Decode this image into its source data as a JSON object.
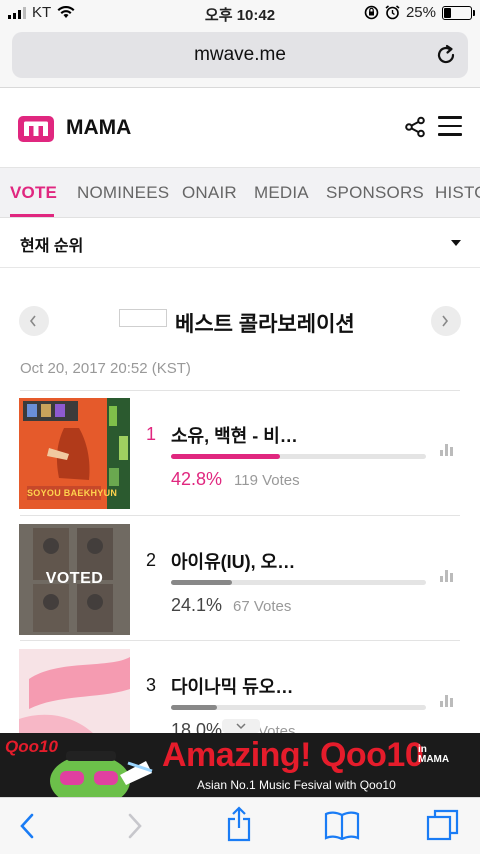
{
  "status_bar": {
    "carrier": "KT",
    "time": "오후 10:42",
    "battery": "25%",
    "battery_level": 0.25
  },
  "browser": {
    "url": "mwave.me"
  },
  "header": {
    "brand": "MAMA",
    "accent_color": "#e0277f"
  },
  "tabs": [
    {
      "label": "VOTE",
      "active": true
    },
    {
      "label": "NOMINEES"
    },
    {
      "label": "ONAIR"
    },
    {
      "label": "MEDIA"
    },
    {
      "label": "SPONSORS"
    },
    {
      "label": "HISTO"
    }
  ],
  "dropdown": {
    "label": "현재 순위"
  },
  "category": {
    "title": "베스트 콜라보레이션"
  },
  "timestamp": "Oct 20, 2017 20:52 (KST)",
  "entries": [
    {
      "rank": "1",
      "title": "소유, 백현 - 비…",
      "percent": "42.8%",
      "percent_value": 42.8,
      "votes": "119 Votes",
      "thumb_caption": "SOYOU BAEKHYUN"
    },
    {
      "rank": "2",
      "title": "아이유(IU), 오…",
      "percent": "24.1%",
      "percent_value": 24.1,
      "votes": "67 Votes",
      "voted": "VOTED"
    },
    {
      "rank": "3",
      "title": "다이나믹 듀오…",
      "percent": "18.0%",
      "percent_value": 18.0,
      "votes": "Votes"
    }
  ],
  "banner": {
    "brand": "Qoo10",
    "headline": "Amazing! Qoo10",
    "in_label": "in",
    "mama_label": "MAMA",
    "tagline": "Asian No.1 Music Fesival with Qoo10"
  }
}
